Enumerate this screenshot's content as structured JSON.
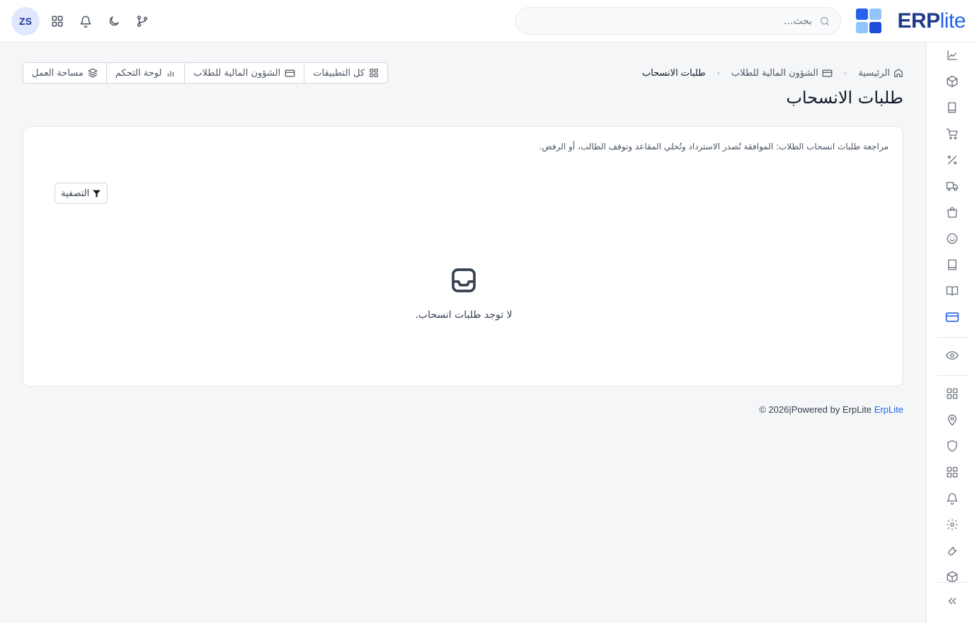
{
  "app": {
    "brand_main": "ERP",
    "brand_accent": "lite",
    "colors": {
      "brand_dark": "#1e3a8a",
      "brand": "#2563eb",
      "brand_light": "#93c5fd"
    }
  },
  "header": {
    "search_placeholder": "بحث...",
    "avatar_initials": "ZS",
    "icons": [
      "apps-grid-icon",
      "bell-icon",
      "moon-icon",
      "git-branch-icon"
    ]
  },
  "breadcrumb": {
    "home": "الرئيسية",
    "section": "الشؤون المالية للطلاب",
    "current": "طلبات الانسحاب"
  },
  "page": {
    "title": "طلبات الانسحاب"
  },
  "tabs": [
    {
      "label": "كل التطبيقات",
      "icon": "grid-icon"
    },
    {
      "label": "الشؤون المالية للطلاب",
      "icon": "credit-card-icon"
    },
    {
      "label": "لوحة التحكم",
      "icon": "bar-chart-icon"
    },
    {
      "label": "مساحة العمل",
      "icon": "layers-icon"
    }
  ],
  "card": {
    "description": "مراجعة طلبات انسحاب الطلاب: الموافقة تُصدر الاسترداد وتُخلي المقاعد وتوقف الطالب، أو الرفض.",
    "filter_label": "التصفية",
    "empty_text": "لا توجد طلبات انسحاب."
  },
  "footer": {
    "link_text": "ErpLite",
    "text": " © 2026|Powered by ErpLite"
  },
  "sidebar": {
    "items": [
      "chart-icon",
      "box-icon",
      "book-icon",
      "cart-icon",
      "percent-icon",
      "truck-icon",
      "shopping-bag-icon",
      "smile-icon",
      "notebook-icon",
      "book-open-icon",
      "credit-card-icon",
      "eye-icon",
      "grid-icon",
      "map-pin-icon",
      "shield-icon",
      "grid-icon",
      "bell-icon",
      "settings-icon",
      "wrench-icon",
      "package-icon",
      "chevrons-right-icon"
    ]
  }
}
